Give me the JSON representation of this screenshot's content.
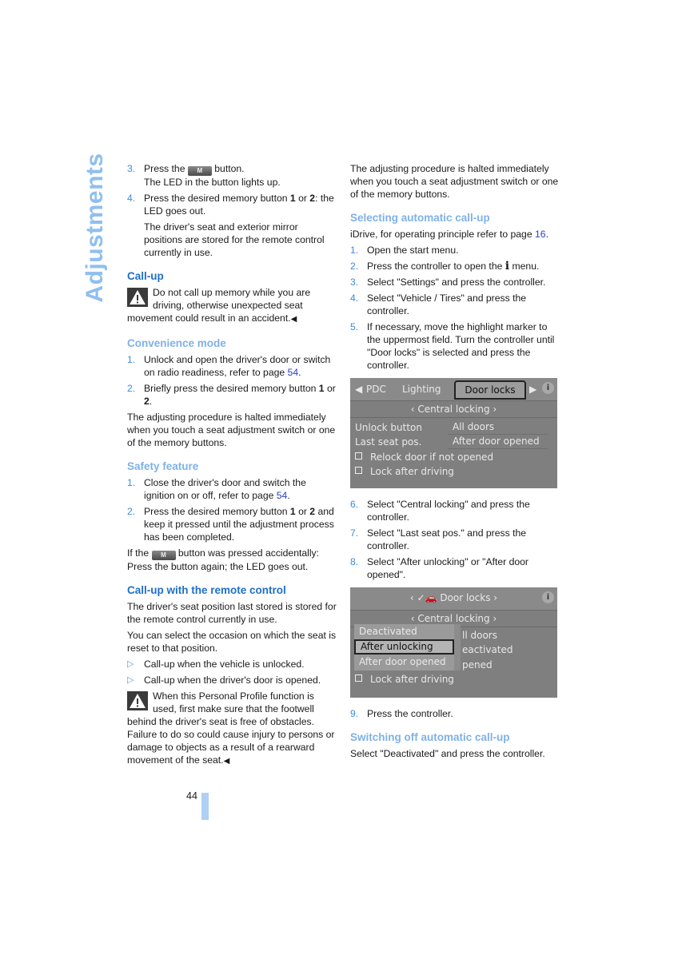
{
  "section_title": "Adjustments",
  "page_number": "44",
  "left_column": {
    "steps_top": [
      {
        "num": "3.",
        "before": "Press the",
        "button": "M",
        "after": "button.",
        "line2": "The LED in the button lights up."
      },
      {
        "num": "4.",
        "text_a": "Press the desired memory button ",
        "b1": "1",
        "text_b": " or ",
        "b2": "2",
        "text_c": ": the LED goes out."
      }
    ],
    "step4_note": "The driver's seat and exterior mirror positions are stored for the remote control currently in use.",
    "callup": {
      "heading": "Call-up",
      "warning": "Do not call up memory while you are driving, otherwise unexpected seat movement could result in an accident.",
      "end_mark": "◀"
    },
    "convenience": {
      "heading": "Convenience mode",
      "step1_num": "1.",
      "step1_text": "Unlock and open the driver's door or switch on radio readiness, refer to page ",
      "step1_link": "54",
      "step2_num": "2.",
      "step2_a": "Briefly press the desired memory button ",
      "step2_b1": "1",
      "step2_b": " or ",
      "step2_b2": "2",
      "step2_c": ".",
      "note": "The adjusting procedure is halted immediately when you touch a seat adjustment switch or one of the memory buttons."
    },
    "safety": {
      "heading": "Safety feature",
      "step1_num": "1.",
      "step1_text": "Close the driver's door and switch the ignition on or off, refer to page ",
      "step1_link": "54",
      "step2_num": "2.",
      "step2_a": "Press the desired memory button ",
      "step2_b1": "1",
      "step2_b": " or ",
      "step2_b2": "2",
      "step2_c": " and keep it pressed until the adjustment process has been completed.",
      "note_before": "If the",
      "note_button": "M",
      "note_after": "button was pressed accidentally: Press the button again; the LED goes out."
    },
    "remote": {
      "heading": "Call-up with the remote control",
      "p1": "The driver's seat position last stored is stored for the remote control currently in use.",
      "p2": "You can select the occasion on which the seat is reset to that position.",
      "bullets": [
        "Call-up when the vehicle is unlocked.",
        "Call-up when the driver's door is opened."
      ],
      "bullet_glyph": "▷",
      "warning": "When this Personal Profile function is used, first make sure that the footwell behind the driver's seat is free of obstacles. Failure to do so could cause injury to persons or damage to objects as a result of a rearward movement of the seat.",
      "end_mark": "◀"
    }
  },
  "right_column": {
    "intro": "The adjusting procedure is halted immediately when you touch a seat adjustment switch or one of the memory buttons.",
    "selecting": {
      "heading": "Selecting automatic call-up",
      "idrive_text": "iDrive, for operating principle refer to page ",
      "idrive_link": "16",
      "steps": [
        {
          "num": "1.",
          "text": "Open the start menu."
        },
        {
          "num": "2.",
          "text_a": "Press the controller to open the ",
          "icon": "i",
          "text_b": " menu."
        },
        {
          "num": "3.",
          "text": "Select \"Settings\" and press the controller."
        },
        {
          "num": "4.",
          "text": "Select \"Vehicle / Tires\" and press the controller."
        },
        {
          "num": "5.",
          "text": "If necessary, move the highlight marker to the uppermost field. Turn the controller until \"Door locks\" is selected and press the controller."
        }
      ]
    },
    "screen1": {
      "tabs": [
        "PDC",
        "Lighting",
        "Door locks"
      ],
      "active_tab": "Door locks",
      "subheader": "‹ Central locking ›",
      "rows": [
        {
          "label": "Unlock button",
          "value": "All doors"
        },
        {
          "label": "Last seat pos.",
          "value": "After door opened"
        }
      ],
      "checkboxes": [
        "Relock door if not opened",
        "Lock after driving"
      ]
    },
    "steps_after": [
      {
        "num": "6.",
        "text": "Select \"Central locking\" and press the controller."
      },
      {
        "num": "7.",
        "text": "Select \"Last seat pos.\" and press the controller."
      },
      {
        "num": "8.",
        "text": "Select \"After unlocking\" or \"After door opened\"."
      }
    ],
    "screen2": {
      "header": "‹ ✓🚗 Door locks ›",
      "subheader": "‹ Central locking ›",
      "popup_options": [
        "Deactivated",
        "After unlocking",
        "After door opened"
      ],
      "selected_option": "After unlocking",
      "bg_values": [
        "ll doors",
        "eactivated",
        "pened"
      ],
      "checkbox": "Lock after driving"
    },
    "step9": {
      "num": "9.",
      "text": "Press the controller."
    },
    "switching_off": {
      "heading": "Switching off automatic call-up",
      "text": "Select \"Deactivated\" and press the controller."
    }
  }
}
